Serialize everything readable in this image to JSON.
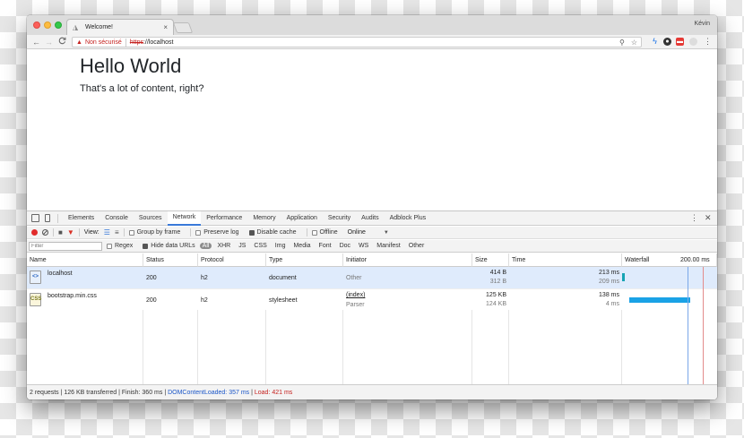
{
  "browser": {
    "tab_title": "Welcome!",
    "tab_close": "×",
    "profile_name": "Kévin",
    "nav": {
      "back": "←",
      "forward": "→",
      "reload": "C"
    },
    "omnibox": {
      "warning_icon": "▲",
      "security_label": "Non sécurisé",
      "scheme": "https",
      "host": "://localhost"
    }
  },
  "page": {
    "heading": "Hello World",
    "lead": "That's a lot of content, right?"
  },
  "devtools": {
    "tabs": [
      "Elements",
      "Console",
      "Sources",
      "Network",
      "Performance",
      "Memory",
      "Application",
      "Security",
      "Audits",
      "Adblock Plus"
    ],
    "active_tab": "Network",
    "toolbar": {
      "view_label": "View:",
      "group_by_frame": "Group by frame",
      "preserve_log": "Preserve log",
      "disable_cache": "Disable cache",
      "offline": "Offline",
      "throttle": "Online"
    },
    "filterbar": {
      "placeholder": "Filter",
      "regex": "Regex",
      "hide_data_urls": "Hide data URLs",
      "types": [
        "All",
        "XHR",
        "JS",
        "CSS",
        "Img",
        "Media",
        "Font",
        "Doc",
        "WS",
        "Manifest",
        "Other"
      ]
    },
    "columns": [
      "Name",
      "Status",
      "Protocol",
      "Type",
      "Initiator",
      "Size",
      "Time",
      "Waterfall"
    ],
    "waterfall_scale": "200.00 ms",
    "rows": [
      {
        "name": "localhost",
        "icon": "<>",
        "status": "200",
        "protocol": "h2",
        "type": "document",
        "initiator": "Other",
        "initiator_sub": "",
        "size": "414 B",
        "size_sub": "312 B",
        "time": "213 ms",
        "time_sub": "209 ms"
      },
      {
        "name": "bootstrap.min.css",
        "icon": "CSS",
        "status": "200",
        "protocol": "h2",
        "type": "stylesheet",
        "initiator": "(index)",
        "initiator_sub": "Parser",
        "size": "125 KB",
        "size_sub": "124 KB",
        "time": "138 ms",
        "time_sub": "4 ms"
      }
    ],
    "status": {
      "summary": "2 requests | 126 KB transferred | Finish: 360 ms | ",
      "dom_content_loaded": "DOMContentLoaded: 357 ms",
      "divider": " | ",
      "load": "Load: 421 ms"
    }
  },
  "colors": {
    "accent": "#3879d9",
    "waterfall_bar": "#1aa2e6",
    "error": "#c5221f"
  }
}
